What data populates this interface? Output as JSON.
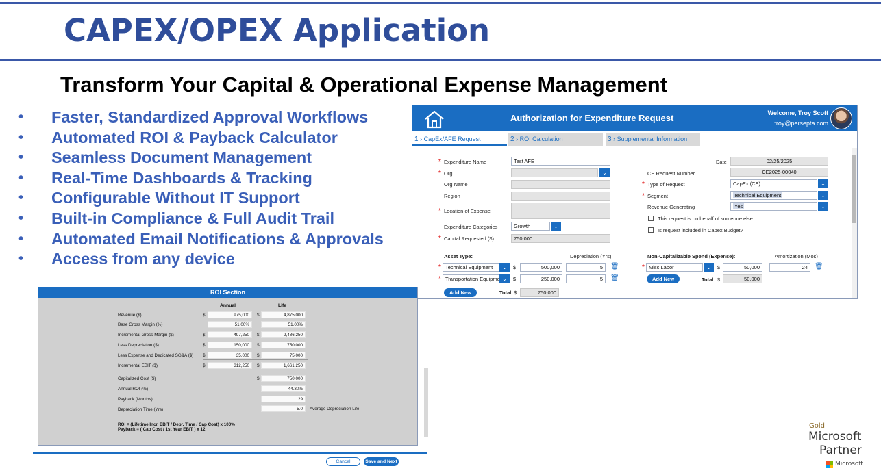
{
  "slide": {
    "title": "CAPEX/OPEX Application",
    "subtitle": "Transform Your Capital & Operational Expense Management",
    "features": [
      "Faster, Standardized Approval Workflows",
      "Automated ROI & Payback Calculator",
      "Seamless Document Management",
      "Real-Time Dashboards & Tracking",
      "Configurable Without IT Support",
      "Built-in Compliance & Full Audit Trail",
      "Automated Email Notifications & Approvals",
      "Access from any device"
    ],
    "bullet": "•"
  },
  "afe": {
    "title": "Authorization for Expenditure Request",
    "welcome": "Welcome, Troy Scott",
    "email": "troy@persepta.com",
    "tabs": [
      {
        "num": "1",
        "label": "CapEx/AFE Request"
      },
      {
        "num": "2",
        "label": "ROI Calculation"
      },
      {
        "num": "3",
        "label": "Supplemental Information"
      }
    ],
    "left": {
      "expenditure_name_label": "Expenditure Name",
      "expenditure_name_value": "Test AFE",
      "org_label": "Org",
      "org_name_label": "Org Name",
      "region_label": "Region",
      "location_label": "Location of Expense",
      "categories_label": "Expenditure Categories",
      "categories_value": "Growth",
      "capital_label": "Capital Requested ($)",
      "capital_value": "750,000"
    },
    "right": {
      "date_label": "Date",
      "date_value": "02/25/2025",
      "ce_label": "CE Request Number",
      "ce_value": "CE2025-00040",
      "type_label": "Type of Request",
      "type_value": "CapEx (CE)",
      "segment_label": "Segment",
      "segment_value": "Technical Equipment",
      "revenue_label": "Revenue Generating",
      "revenue_value": "Yes",
      "behalf_label": "This request is on behalf of someone else.",
      "budget_label": "Is request included in Capex Budget?"
    },
    "assets": {
      "asset_type_label": "Asset Type:",
      "depreciation_label": "Depreciation (Yrs)",
      "rows": [
        {
          "type": "Technical Equipment",
          "amount": "500,000",
          "years": "5"
        },
        {
          "type": "Transportation Equipment",
          "amount": "250,000",
          "years": "5"
        }
      ],
      "add_new": "Add New",
      "total_label": "Total",
      "total_value": "750,000",
      "currency": "$"
    },
    "noncap": {
      "label": "Non-Capitalizable Spend (Expense):",
      "amortization_label": "Amortization (Mos)",
      "row": {
        "type": "Misc Labor",
        "amount": "50,000",
        "months": "24"
      },
      "add_new": "Add New",
      "total_label": "Total",
      "total_value": "50,000",
      "currency": "$"
    }
  },
  "roi": {
    "title": "ROI Section",
    "col_annual": "Annual",
    "col_life": "Life",
    "currency": "$",
    "rows": [
      {
        "label": "Revenue ($)",
        "annual": "975,000",
        "life": "4,875,000",
        "dollar": true
      },
      {
        "label": "Base Gross Margin (%)",
        "annual": "51.00%",
        "life": "51.00%",
        "dollar": false
      },
      {
        "label": "Incremental Gross Margin ($)",
        "annual": "497,250",
        "life": "2,486,250",
        "dollar": true
      },
      {
        "label": "Less Depreciation ($)",
        "annual": "150,000",
        "life": "750,000",
        "dollar": true
      },
      {
        "label": "Less Expense and Dedicated SG&A ($)",
        "annual": "35,000",
        "life": "75,000",
        "dollar": true
      },
      {
        "label": "Incremental EBIT ($)",
        "annual": "312,250",
        "life": "1,661,250",
        "dollar": true
      }
    ],
    "capitalized_label": "Capitalized Cost ($)",
    "capitalized_value": "750,000",
    "annual_roi_label": "Annual ROI (%)",
    "annual_roi_value": "44.30%",
    "payback_label": "Payback (Months)",
    "payback_value": "29",
    "depr_time_label": "Depreciation Time (Yrs)",
    "depr_time_value": "5.0",
    "depr_note": "Average Depreciation Life",
    "formula1": "ROI = (Lifetime Incr. EBIT / Depr. Time / Cap Cost) x 100%",
    "formula2": "Payback = ( Cap Cost  / 1st Year EBIT ) x 12"
  },
  "buttons": {
    "cancel": "Cancel",
    "save": "Save and Next"
  },
  "partner": {
    "tier": "Gold",
    "line1": "Microsoft",
    "line2": "Partner",
    "brand": "Microsoft"
  }
}
